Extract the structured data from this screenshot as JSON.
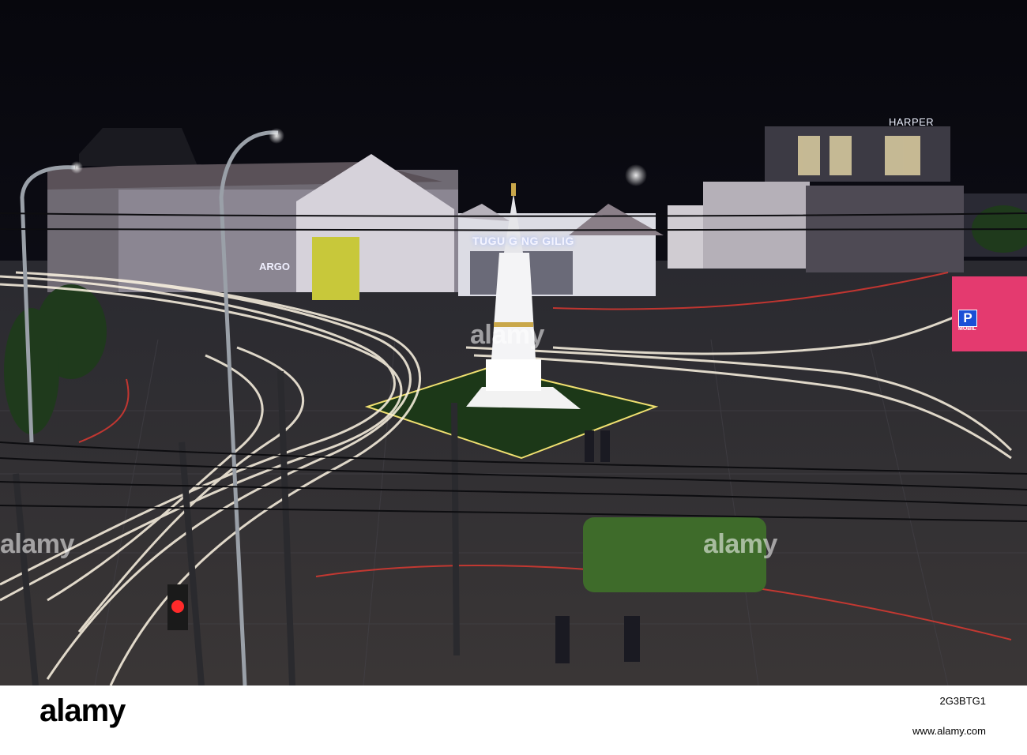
{
  "signs": {
    "tugu": "TUGU G   NG GILIG",
    "harper": "HARPER",
    "argo": "ARGO",
    "parking": "P",
    "mobil": "MOBIL"
  },
  "watermark": {
    "text": "alamy"
  },
  "footer": {
    "logo": "alamy",
    "image_id": "2G3BTG1",
    "site": "www.alamy.com"
  }
}
